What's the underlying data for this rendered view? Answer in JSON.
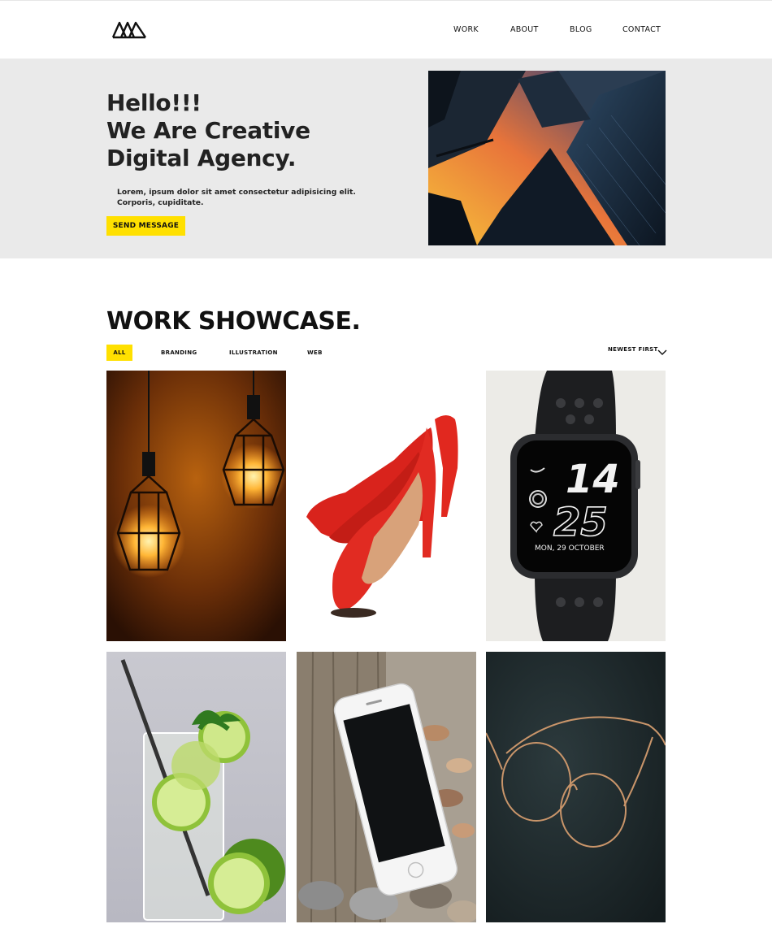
{
  "header": {
    "logo_name": "m-logo",
    "nav": [
      "WORK",
      "ABOUT",
      "BLOG",
      "CONTACT"
    ]
  },
  "hero": {
    "title_lines": [
      "Hello!!!",
      "We Are Creative",
      "Digital Agency."
    ],
    "text": "Lorem, ipsum dolor sit amet consectetur adipisicing elit. Corporis, cupiditate.",
    "button_label": "SEND MESSAGE",
    "image": "skyscrapers-sunset-photo"
  },
  "showcase": {
    "title": "WORK SHOWCASE.",
    "filters": [
      "ALL",
      "BRANDING",
      "ILLUSTRATION",
      "WEB"
    ],
    "active_filter": "ALL",
    "sort_label": "NEWEST FIRST",
    "watch_hour": "14",
    "watch_minute": "25",
    "watch_date": "MON, 29 OCTOBER",
    "tiles": [
      "pendant-lamps-photo",
      "red-heels-photo",
      "smartwatch-photo",
      "lime-drink-photo",
      "smartphone-photo",
      "eyeglasses-photo"
    ]
  },
  "colors": {
    "accent": "#ffe000",
    "hero_bg": "#eaeaea",
    "text": "#111111"
  }
}
